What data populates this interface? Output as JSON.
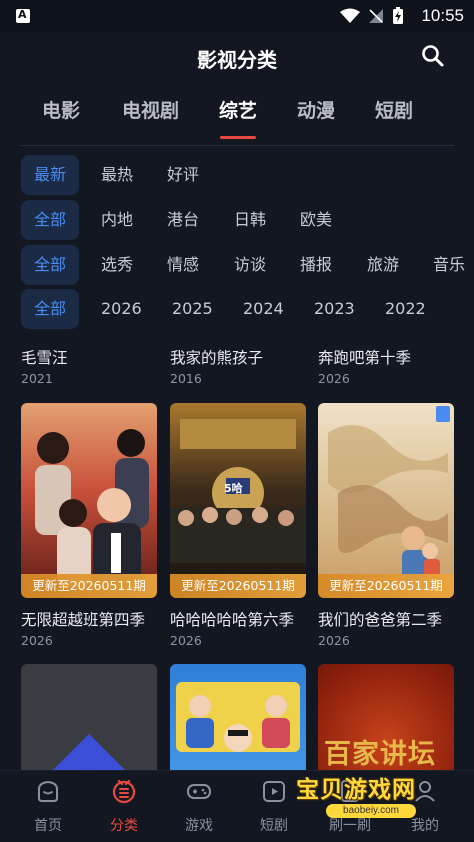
{
  "status_bar": {
    "time": "10:55"
  },
  "header": {
    "title": "影视分类"
  },
  "tabs": [
    {
      "label": "电影"
    },
    {
      "label": "电视剧"
    },
    {
      "label": "综艺",
      "active": true
    },
    {
      "label": "动漫"
    },
    {
      "label": "短剧"
    }
  ],
  "filters": {
    "sort": [
      "最新",
      "最热",
      "好评"
    ],
    "region": [
      "全部",
      "内地",
      "港台",
      "日韩",
      "欧美"
    ],
    "genre": [
      "全部",
      "选秀",
      "情感",
      "访谈",
      "播报",
      "旅游",
      "音乐"
    ],
    "year": [
      "全部",
      "2026",
      "2025",
      "2024",
      "2023",
      "2022"
    ]
  },
  "items": [
    {
      "title": "毛雪汪",
      "year": "2021"
    },
    {
      "title": "我家的熊孩子",
      "year": "2016"
    },
    {
      "title": "奔跑吧第十季",
      "year": "2026"
    },
    {
      "title": "无限超越班第四季",
      "year": "2026",
      "badge": "更新至20260511期"
    },
    {
      "title": "哈哈哈哈哈第六季",
      "year": "2026",
      "badge": "更新至20260511期"
    },
    {
      "title": "我们的爸爸第二季",
      "year": "2026",
      "badge": "更新至20260511期"
    }
  ],
  "posters": {
    "p7_text": "百家讲坛",
    "p5_logo": "5哈"
  },
  "bottom_nav": [
    {
      "label": "首页"
    },
    {
      "label": "分类",
      "active": true
    },
    {
      "label": "游戏"
    },
    {
      "label": "短剧"
    },
    {
      "label": "刷一刷"
    },
    {
      "label": "我的"
    }
  ],
  "watermark": {
    "title": "宝贝游戏网",
    "url": "baobeiy.com"
  },
  "colors": {
    "accent": "#e8493f",
    "chip_active": "#4a8cf2",
    "background": "#121722",
    "badge": "#e0962e"
  }
}
